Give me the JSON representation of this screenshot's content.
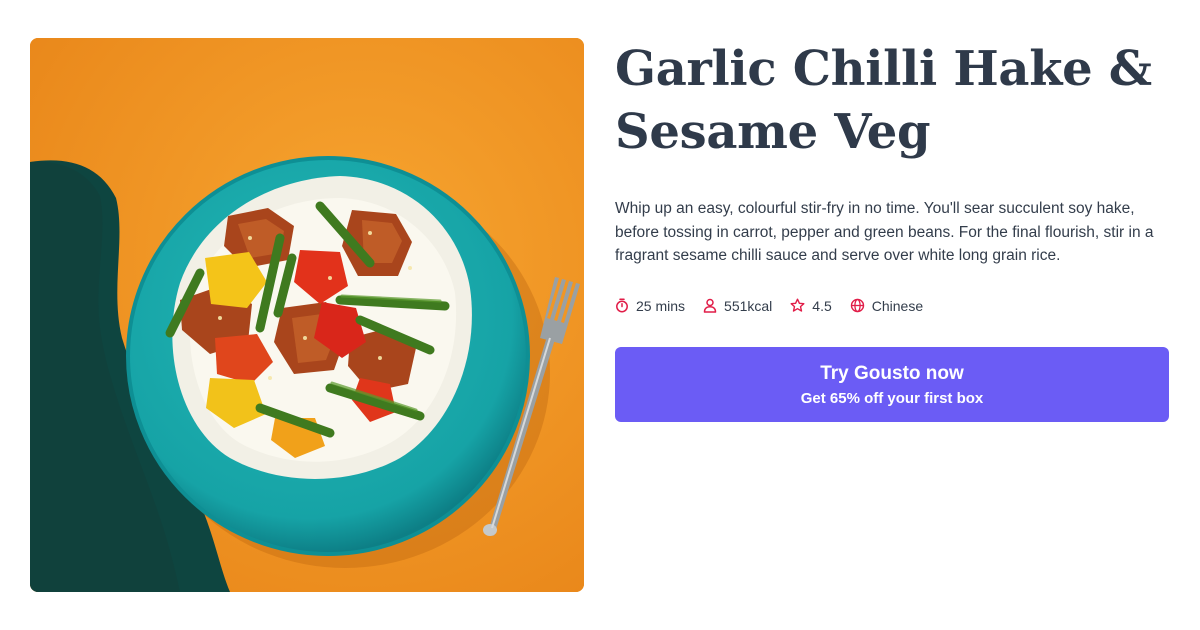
{
  "recipe": {
    "title_line1": "Garlic Chilli Hake &",
    "title_line2": "Sesame Veg",
    "description": "Whip up an easy, colourful stir-fry in no time. You'll sear succulent soy hake, before tossing in carrot, pepper and green beans. For the final flourish, stir in a fragrant sesame chilli sauce and serve over white long grain rice.",
    "meta": {
      "time": "25 mins",
      "calories": "551kcal",
      "rating": "4.5",
      "cuisine": "Chinese"
    }
  },
  "cta": {
    "label": "Try Gousto now",
    "sublabel": "Get 65% off your first box"
  },
  "colors": {
    "accent": "#6b5cf5",
    "icon": "#e11d48",
    "title": "#2f3a4a",
    "text": "#333d4b"
  },
  "icons": [
    "stopwatch-icon",
    "person-icon",
    "star-icon",
    "globe-icon"
  ]
}
